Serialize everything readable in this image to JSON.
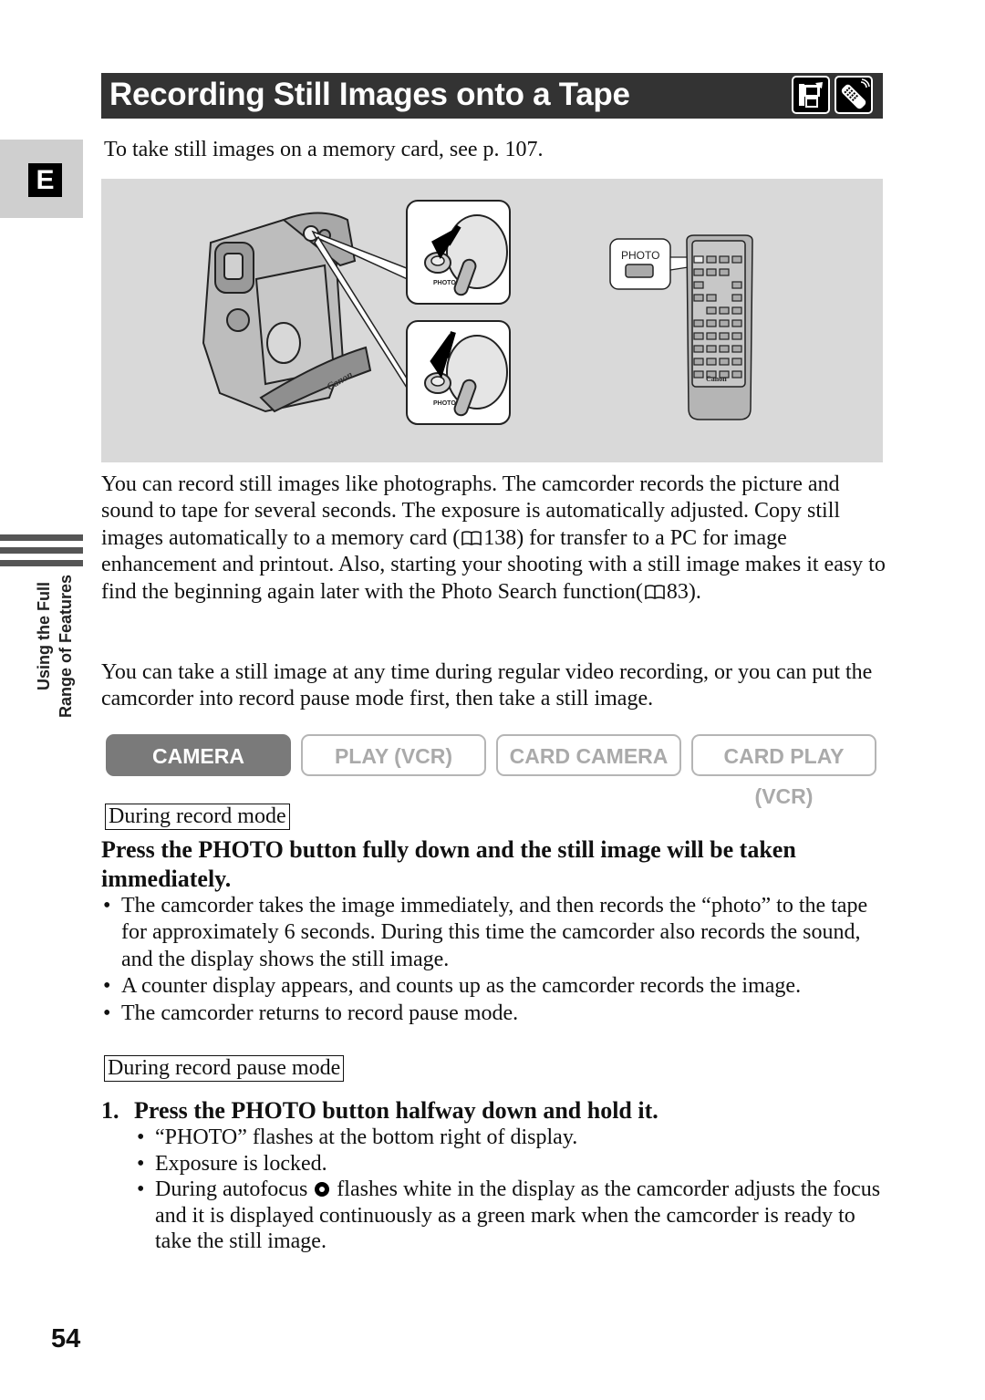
{
  "header": {
    "title": "Recording Still Images onto a Tape",
    "icons": [
      "camcorder-icon",
      "wireless-remote-icon"
    ]
  },
  "side_tab": {
    "letter": "E",
    "section_label_line1": "Using the Full",
    "section_label_line2": "Range of Features"
  },
  "intro": "To take still images on a memory card, see p. 107.",
  "illustration": {
    "remote_button_label": "PHOTO",
    "camcorder_brand": "Canon",
    "remote_brand": "Canon",
    "detail_label": "PHOTO"
  },
  "paragraph1": {
    "part1": "You can record still images like photographs. The camcorder records the picture and sound to tape for several seconds. The exposure is automatically adjusted. Copy still images automatically to a memory card (",
    "ref1": "138",
    "part2": ") for transfer to a PC for image enhancement and printout. Also, starting your shooting with a still image makes it easy to find the beginning again later with the Photo Search function(",
    "ref2": "83",
    "part3": ")."
  },
  "paragraph2": "You can take a still image at any time during regular video recording, or you can put the camcorder into record pause mode first, then take a still image.",
  "modes": [
    {
      "label": "CAMERA",
      "active": true
    },
    {
      "label": "PLAY (VCR)",
      "active": false
    },
    {
      "label": "CARD CAMERA",
      "active": false
    },
    {
      "label": "CARD PLAY (VCR)",
      "active": false
    }
  ],
  "record_mode": {
    "label": "During record mode",
    "heading": "Press the PHOTO button fully down and the still image will be taken immediately.",
    "bullets": [
      "The camcorder takes the image immediately, and then records the “photo” to the tape for approximately 6 seconds. During this time the camcorder also records the sound, and the display shows the still image.",
      "A counter display appears, and counts up as the camcorder records the image.",
      "The camcorder returns to record pause mode."
    ]
  },
  "pause_mode": {
    "label": "During record pause mode",
    "step_number": "1.",
    "step_text": "Press the PHOTO button halfway down and hold it.",
    "bullets": [
      "“PHOTO” flashes at the bottom right of display.",
      "Exposure is locked."
    ],
    "autofocus_bullet_part1": "During autofocus",
    "autofocus_bullet_part2": "flashes white in the display as the camcorder adjusts the focus and it is displayed continuously as a green mark when the camcorder is ready to take the still image."
  },
  "page_number": "54"
}
